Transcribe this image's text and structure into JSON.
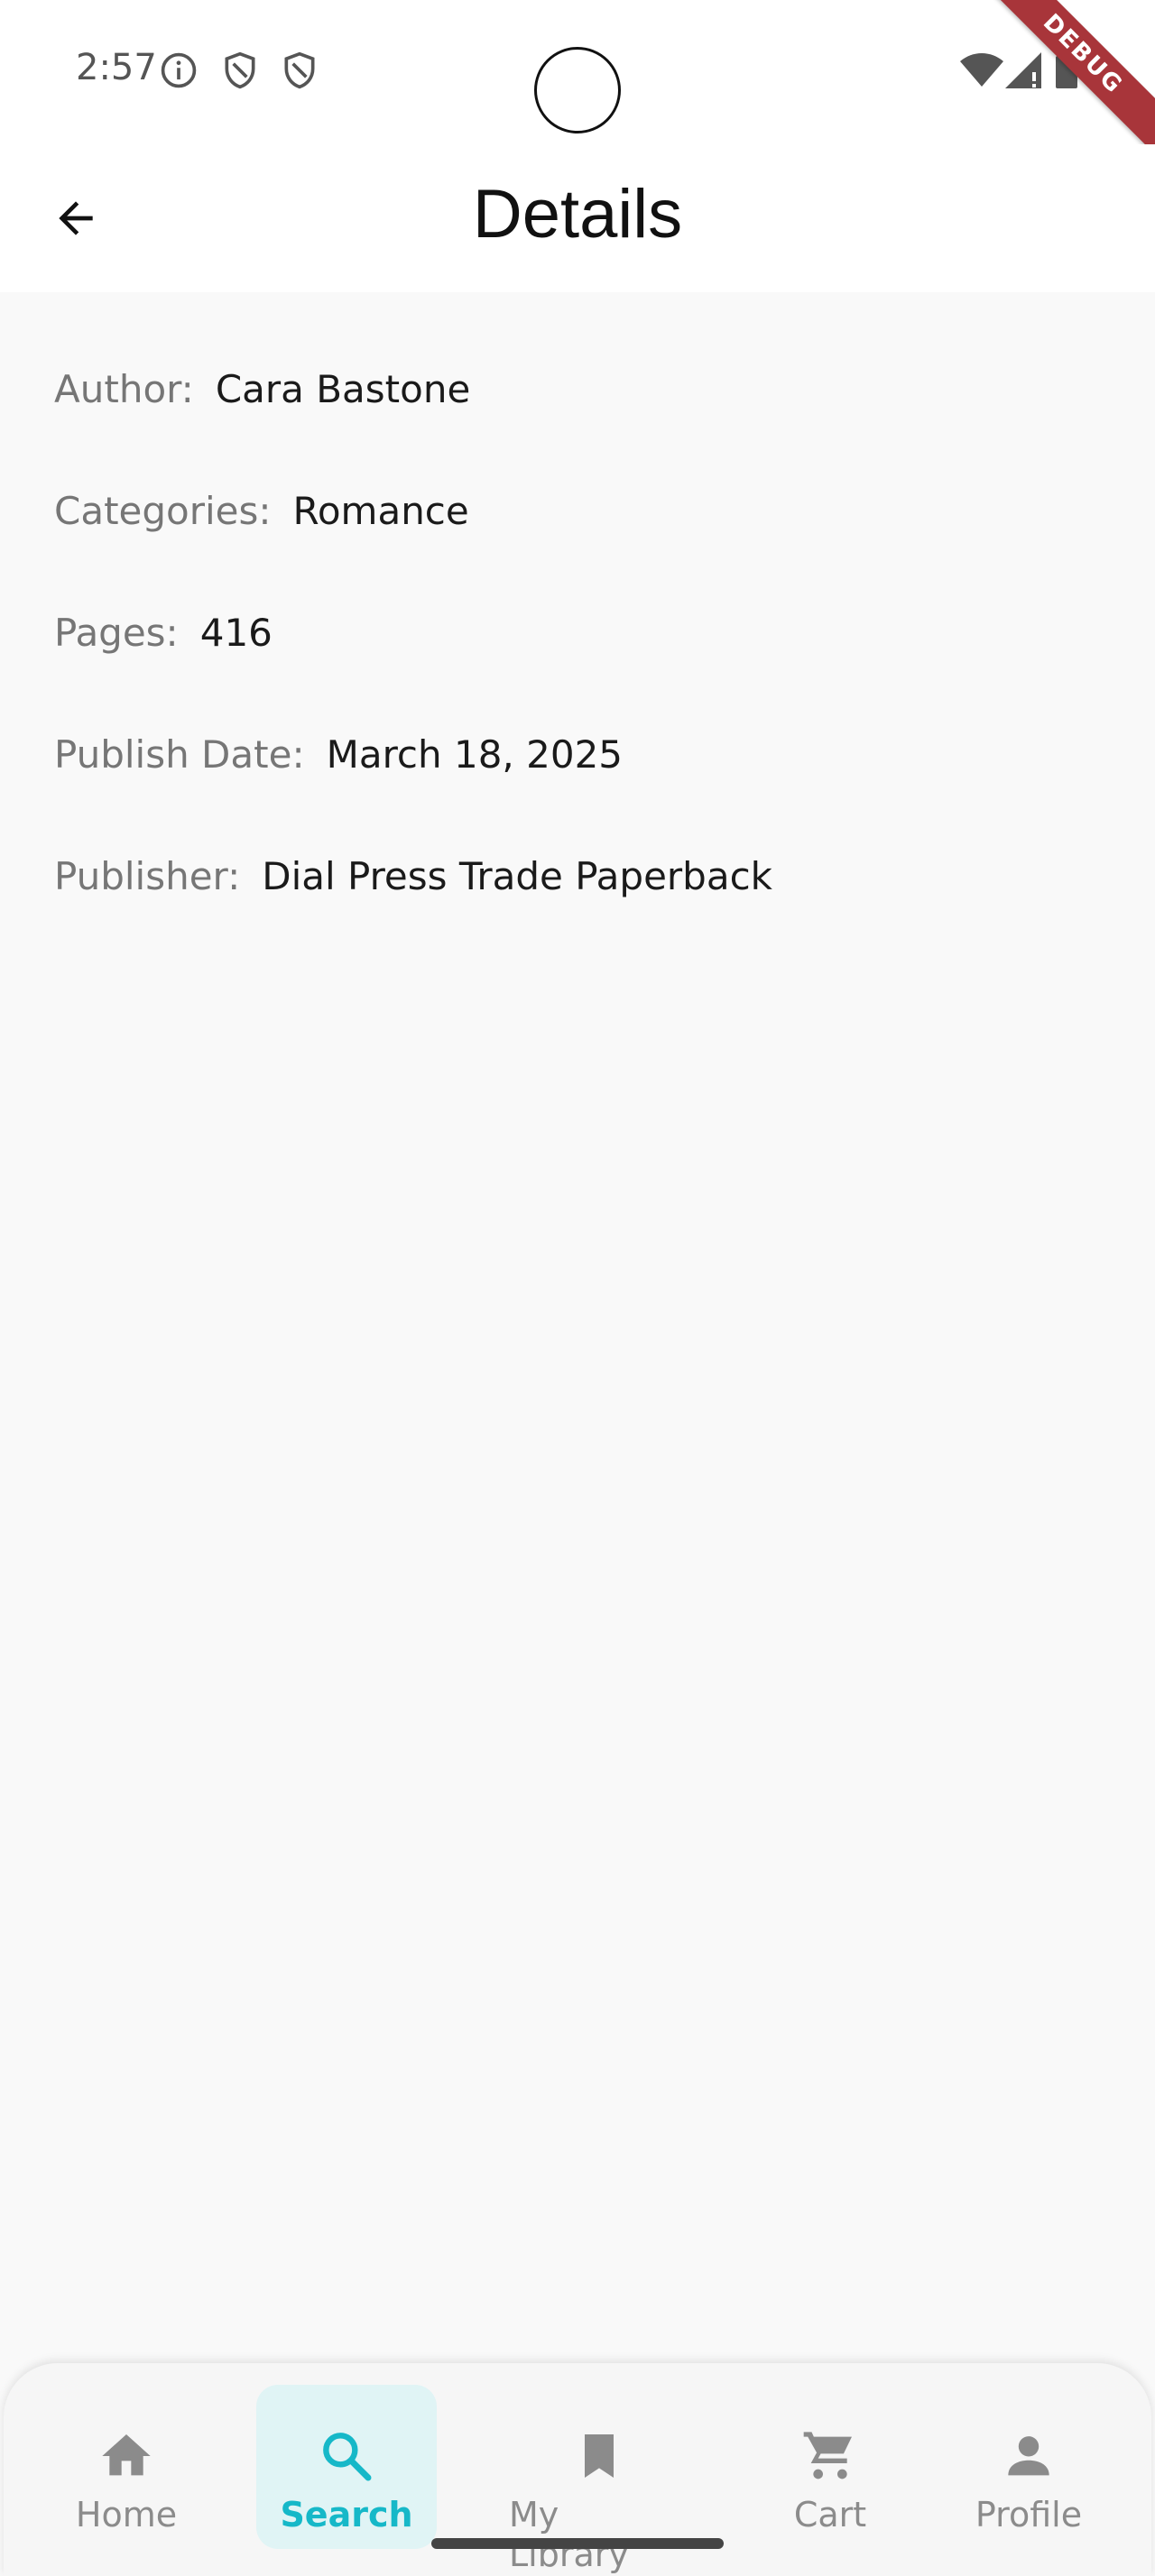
{
  "status_bar": {
    "time": "2:57",
    "left_icons": [
      "info-icon",
      "shield-icon",
      "shield-icon"
    ],
    "right_icons": [
      "wifi-icon",
      "signal-icon",
      "battery-icon"
    ]
  },
  "debug_banner": "DEBUG",
  "app_bar": {
    "back_icon": "arrow-back-icon",
    "title": "Details"
  },
  "details": [
    {
      "label": "Author:",
      "value": "Cara Bastone"
    },
    {
      "label": "Categories:",
      "value": "Romance"
    },
    {
      "label": "Pages:",
      "value": "416"
    },
    {
      "label": "Publish Date:",
      "value": "March 18, 2025"
    },
    {
      "label": "Publisher:",
      "value": "Dial Press Trade Paperback"
    }
  ],
  "bottom_nav": {
    "active": "Search",
    "accent_color": "#16b8c8",
    "items": [
      {
        "label": "Home",
        "icon": "home-icon"
      },
      {
        "label": "Search",
        "icon": "search-icon"
      },
      {
        "label": "My Library",
        "icon": "bookmark-icon"
      },
      {
        "label": "Cart",
        "icon": "cart-icon"
      },
      {
        "label": "Profile",
        "icon": "person-icon"
      }
    ]
  }
}
